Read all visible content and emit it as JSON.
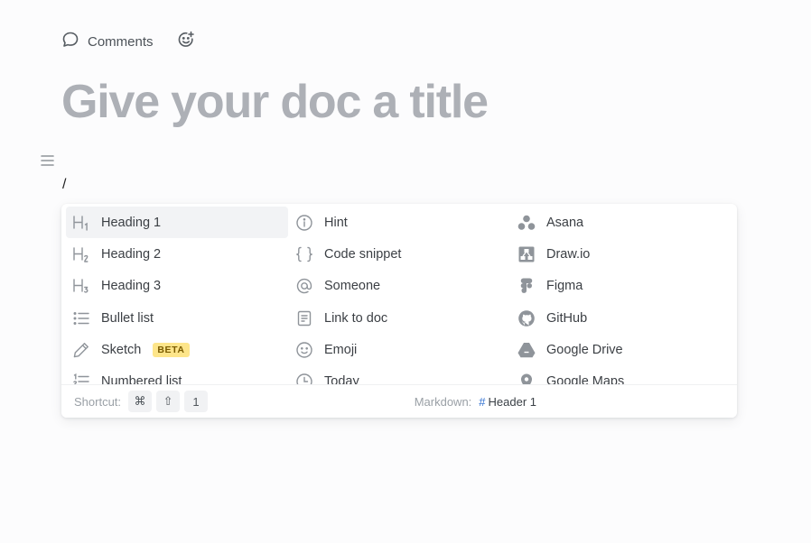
{
  "toolbar": {
    "comments_label": "Comments"
  },
  "document": {
    "title_placeholder": "Give your doc a title",
    "typed_text": "/"
  },
  "menu": {
    "columns": [
      [
        {
          "label": "Heading 1",
          "icon": "heading-1-icon"
        },
        {
          "label": "Heading 2",
          "icon": "heading-2-icon"
        },
        {
          "label": "Heading 3",
          "icon": "heading-3-icon"
        },
        {
          "label": "Bullet list",
          "icon": "bullet-list-icon"
        },
        {
          "label": "Sketch",
          "icon": "pencil-icon",
          "badge": "BETA"
        },
        {
          "label": "Numbered list",
          "icon": "numbered-list-icon"
        }
      ],
      [
        {
          "label": "Hint",
          "icon": "info-icon"
        },
        {
          "label": "Code snippet",
          "icon": "braces-icon"
        },
        {
          "label": "Someone",
          "icon": "at-icon"
        },
        {
          "label": "Link to doc",
          "icon": "doc-link-icon"
        },
        {
          "label": "Emoji",
          "icon": "smiley-icon"
        },
        {
          "label": "Today",
          "icon": "clock-icon"
        }
      ],
      [
        {
          "label": "Asana",
          "icon": "asana-icon"
        },
        {
          "label": "Draw.io",
          "icon": "drawio-icon"
        },
        {
          "label": "Figma",
          "icon": "figma-icon"
        },
        {
          "label": "GitHub",
          "icon": "github-icon"
        },
        {
          "label": "Google Drive",
          "icon": "google-drive-icon"
        },
        {
          "label": "Google Maps",
          "icon": "map-pin-icon"
        }
      ]
    ],
    "footer": {
      "shortcut_label": "Shortcut:",
      "keys": [
        "⌘",
        "⇧",
        "1"
      ],
      "markdown_label": "Markdown:",
      "markdown_hash": "#",
      "markdown_value": "Header 1"
    }
  },
  "colors": {
    "title": "#adb0b6",
    "active_row": "#f2f3f5",
    "badge_bg": "#fde58a",
    "markdown_hash": "#2f6fd0",
    "icon_gray": "#8f949a"
  }
}
